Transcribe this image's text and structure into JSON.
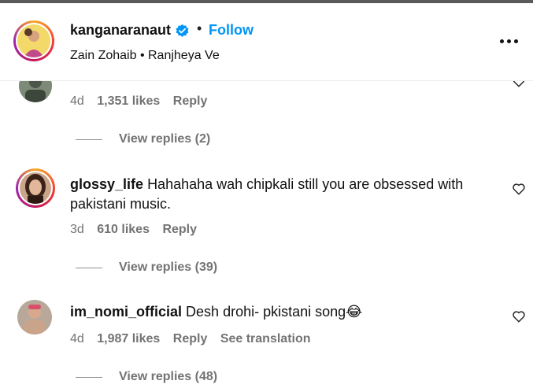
{
  "header": {
    "username": "kanganaranaut",
    "separator": "•",
    "follow_label": "Follow",
    "audio": "Zain Zohaib • Ranjheya Ve",
    "more_icon": "more-options-icon"
  },
  "comments": [
    {
      "age": "4d",
      "likes": "1,351 likes",
      "reply_label": "Reply",
      "view_replies": "View replies (2)"
    },
    {
      "username": "glossy_life",
      "text": "Hahahaha wah chipkali still you are obsessed with pakistani music.",
      "age": "3d",
      "likes": "610 likes",
      "reply_label": "Reply",
      "view_replies": "View replies (39)"
    },
    {
      "username": "im_nomi_official",
      "text": "Desh drohi- pkistani song",
      "emoji": "😂",
      "age": "4d",
      "likes": "1,987 likes",
      "reply_label": "Reply",
      "translate_label": "See translation",
      "view_replies": "View replies (48)"
    }
  ],
  "colors": {
    "follow": "#0095f6",
    "secondary_text": "#737373",
    "verified": "#0095f6"
  }
}
